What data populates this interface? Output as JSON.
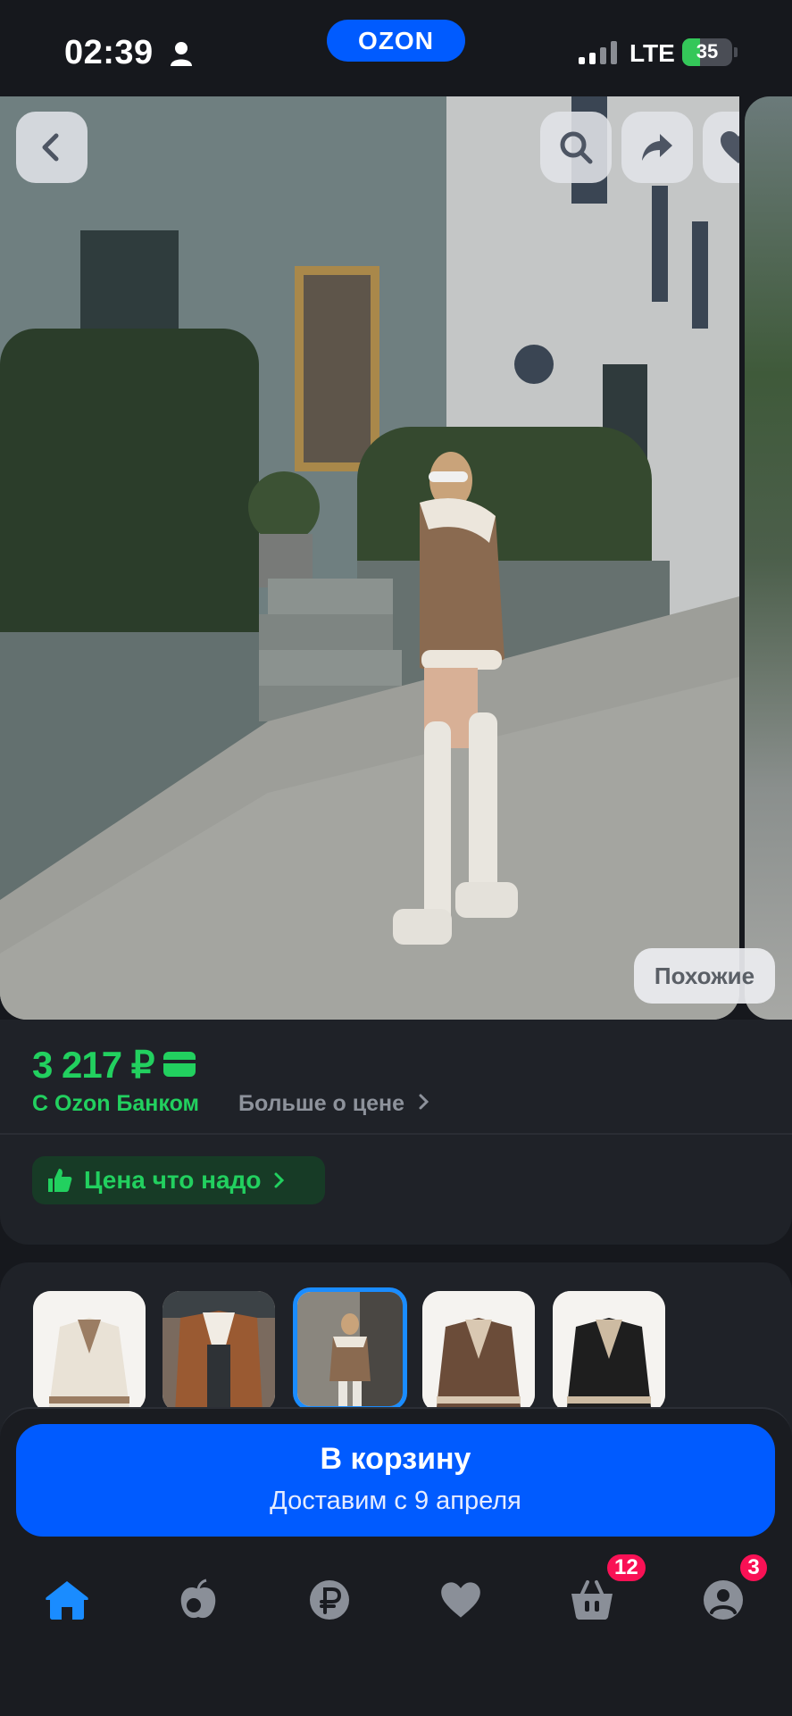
{
  "status_bar": {
    "time": "02:39",
    "network": "LTE",
    "battery": "35",
    "battery_level": 0.35
  },
  "header": {
    "logo": "OZON"
  },
  "photo": {
    "similar_label": "Похожие"
  },
  "price": {
    "value": "3 217 ₽",
    "bank_label": "С Ozon Банком",
    "more_label": "Больше о цене",
    "good_price_label": "Цена что надо"
  },
  "variants": {
    "selected_index": 2,
    "items": [
      {
        "color": "cream-jacket"
      },
      {
        "color": "brown-jacket-model"
      },
      {
        "color": "brown-vest-model"
      },
      {
        "color": "brown-jacket"
      },
      {
        "color": "black-jacket"
      }
    ]
  },
  "cart": {
    "title": "В корзину",
    "subtitle": "Доставим с 9 апреля"
  },
  "nav": {
    "items": [
      {
        "icon": "home-icon",
        "active": true
      },
      {
        "icon": "fresh-icon"
      },
      {
        "icon": "ruble-icon"
      },
      {
        "icon": "heart-icon"
      },
      {
        "icon": "basket-icon",
        "badge": "12"
      },
      {
        "icon": "profile-icon",
        "badge": "3"
      }
    ]
  },
  "colors": {
    "accent": "#005bff",
    "green": "#22d05f",
    "badge": "#f91155",
    "active_nav": "#1a8cff"
  }
}
